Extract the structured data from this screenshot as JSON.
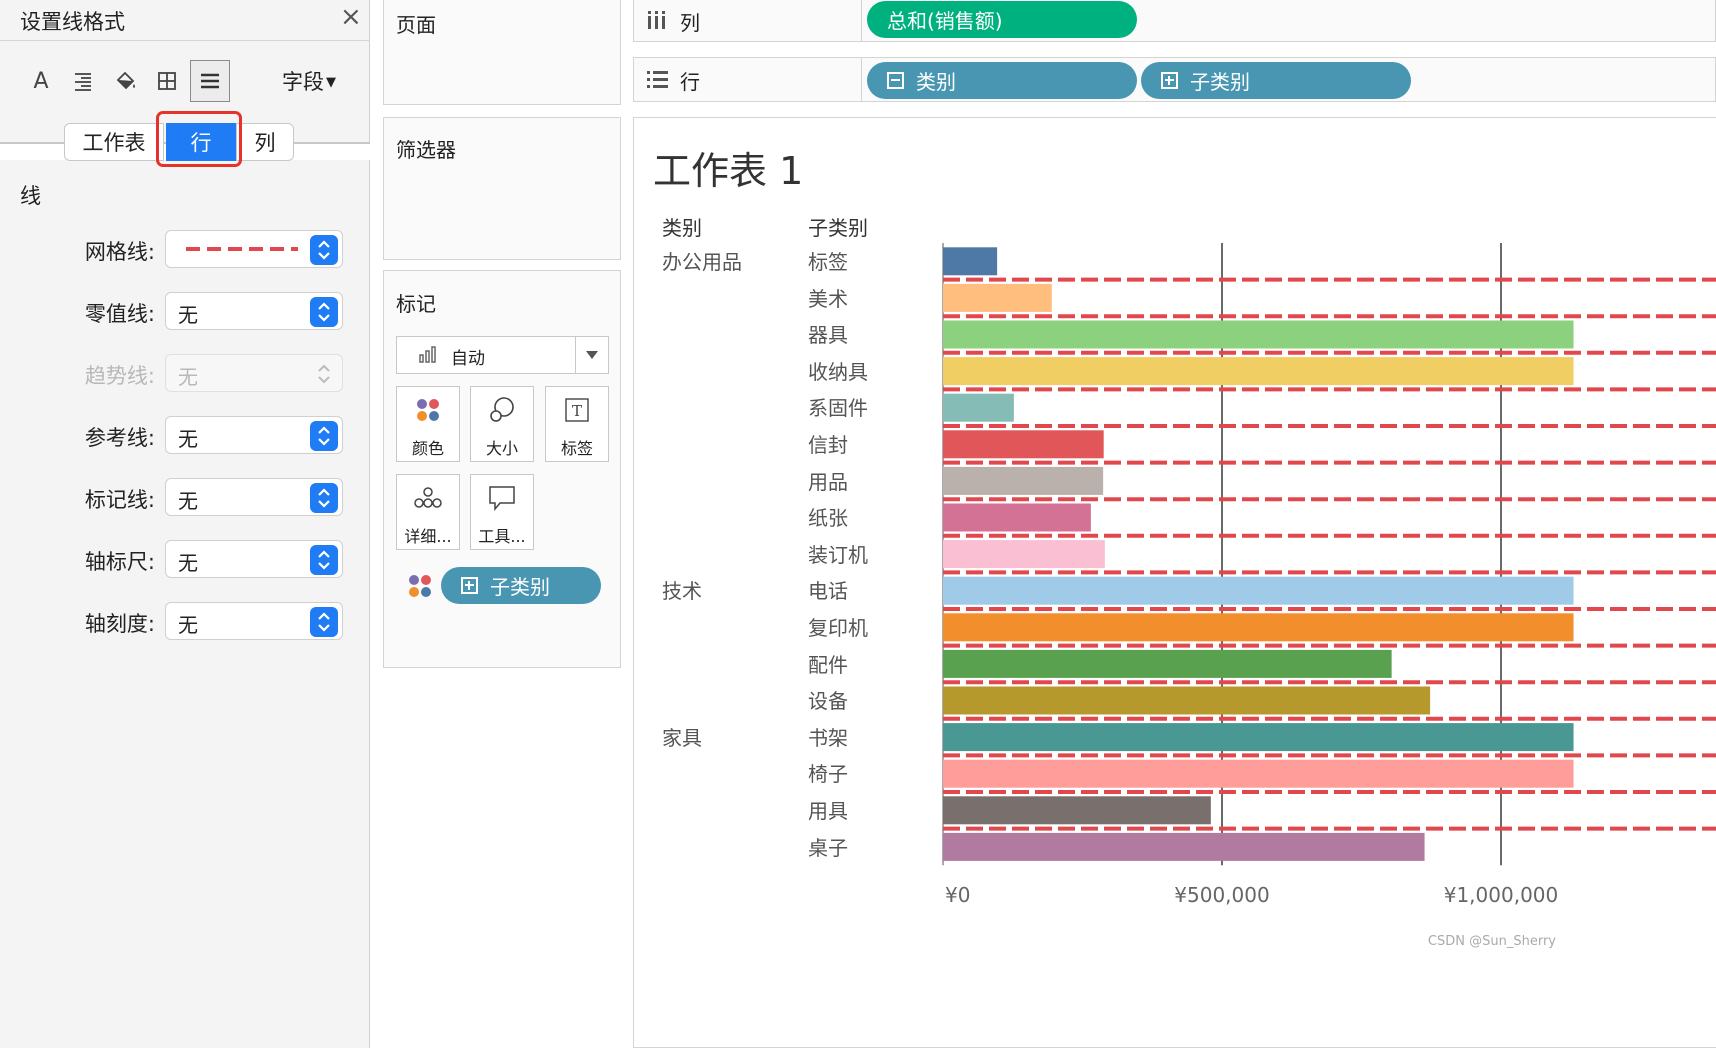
{
  "format_panel": {
    "title": "设置线格式",
    "close_glyph": "×",
    "toolbar": {
      "icons": [
        "font-icon",
        "align-icon",
        "shading-icon",
        "borders-icon",
        "lines-icon"
      ],
      "font_glyph": "A",
      "field_dropdown": "字段"
    },
    "tabs": [
      "工作表",
      "行",
      "列"
    ],
    "selected_tab": "行",
    "section_title": "线",
    "rows": [
      {
        "label": "网格线:",
        "value": "",
        "style": "dashed",
        "color": "#e0484e",
        "enabled": true
      },
      {
        "label": "零值线:",
        "value": "无",
        "enabled": true
      },
      {
        "label": "趋势线:",
        "value": "无",
        "enabled": false
      },
      {
        "label": "参考线:",
        "value": "无",
        "enabled": true
      },
      {
        "label": "标记线:",
        "value": "无",
        "enabled": true
      },
      {
        "label": "轴标尺:",
        "value": "无",
        "enabled": true
      },
      {
        "label": "轴刻度:",
        "value": "无",
        "enabled": true
      }
    ]
  },
  "pages_card": {
    "title": "页面"
  },
  "filters_card": {
    "title": "筛选器"
  },
  "marks_card": {
    "title": "标记",
    "mark_type": "自动",
    "buttons": [
      "颜色",
      "大小",
      "标签",
      "详细...",
      "工具..."
    ],
    "color_pill": "子类别"
  },
  "shelves": {
    "columns_label": "列",
    "columns_pills": [
      "总和(销售额)"
    ],
    "rows_label": "行",
    "rows_pills": [
      "类别",
      "子类别"
    ]
  },
  "sheet": {
    "title": "工作表 1",
    "header_category": "类别",
    "header_subcategory": "子类别"
  },
  "chart_data": {
    "type": "bar",
    "orientation": "horizontal",
    "x_measure": "总和(销售额)",
    "xlim": [
      0,
      1130000
    ],
    "x_ticks": [
      "¥0",
      "¥500,000",
      "¥1,000,000"
    ],
    "x_tick_values": [
      0,
      500000,
      1000000
    ],
    "gridlines": {
      "style": "dashed",
      "color": "#e0484e"
    },
    "groups": [
      {
        "category": "办公用品",
        "rows": [
          {
            "sub": "标签",
            "value": 97000,
            "color": "#4e79a7"
          },
          {
            "sub": "美术",
            "value": 195000,
            "color": "#ffbe7d"
          },
          {
            "sub": "器具",
            "value": 1130000,
            "color": "#8cd17d"
          },
          {
            "sub": "收纳具",
            "value": 1130000,
            "color": "#f1ce63"
          },
          {
            "sub": "系固件",
            "value": 127000,
            "color": "#86bcb6"
          },
          {
            "sub": "信封",
            "value": 288000,
            "color": "#e15759"
          },
          {
            "sub": "用品",
            "value": 287000,
            "color": "#bab0ac"
          },
          {
            "sub": "纸张",
            "value": 265000,
            "color": "#d37295"
          },
          {
            "sub": "装订机",
            "value": 290000,
            "color": "#fabfd2"
          }
        ]
      },
      {
        "category": "技术",
        "rows": [
          {
            "sub": "电话",
            "value": 1130000,
            "color": "#a0cbe8"
          },
          {
            "sub": "复印机",
            "value": 1130000,
            "color": "#f28e2b"
          },
          {
            "sub": "配件",
            "value": 804000,
            "color": "#59a14f"
          },
          {
            "sub": "设备",
            "value": 873000,
            "color": "#b6992d"
          }
        ]
      },
      {
        "category": "家具",
        "rows": [
          {
            "sub": "书架",
            "value": 1130000,
            "color": "#499894"
          },
          {
            "sub": "椅子",
            "value": 1130000,
            "color": "#ff9d9a"
          },
          {
            "sub": "用具",
            "value": 480000,
            "color": "#79706e"
          },
          {
            "sub": "桌子",
            "value": 863000,
            "color": "#b07aa1"
          }
        ]
      }
    ]
  },
  "watermark": "CSDN @Sun_Sherry"
}
